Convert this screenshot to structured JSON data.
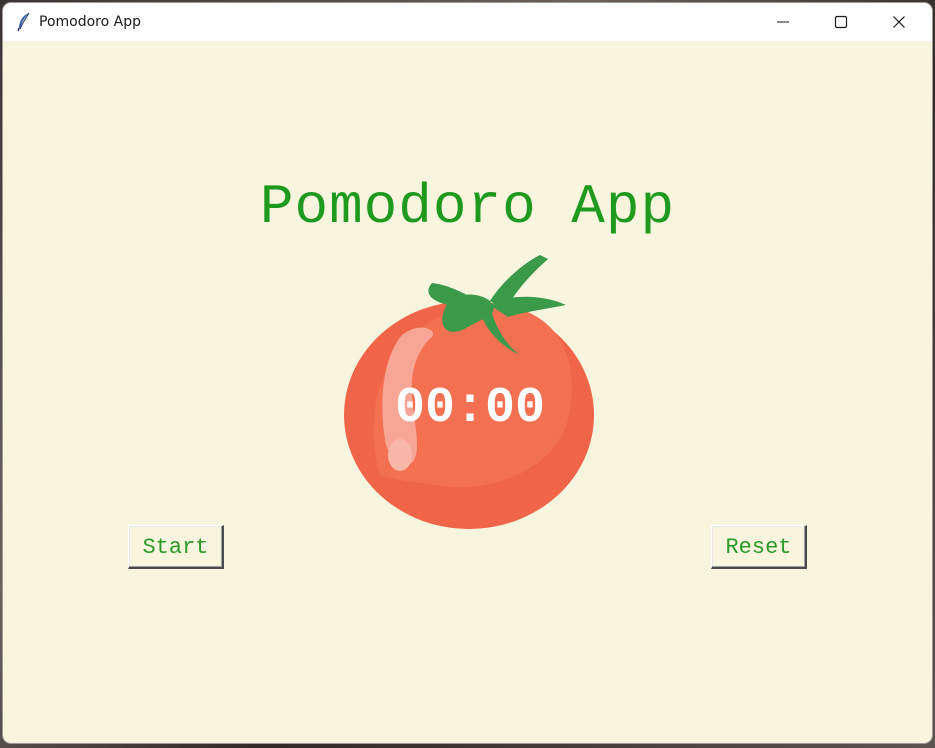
{
  "window": {
    "title": "Pomodoro App",
    "controls": {
      "minimize_icon": "minimize-icon",
      "maximize_icon": "maximize-icon",
      "close_icon": "close-icon"
    }
  },
  "main": {
    "heading": "Pomodoro App",
    "timer": "00:00",
    "start_label": "Start",
    "reset_label": "Reset",
    "image_icon": "tomato-icon"
  },
  "colors": {
    "background": "#f7f5dd",
    "heading": "#1f9a1f",
    "button_text": "#2a9a2a",
    "tomato": "#f06b4f",
    "leaf": "#3a9a4a",
    "timer_text": "#ffffff"
  }
}
